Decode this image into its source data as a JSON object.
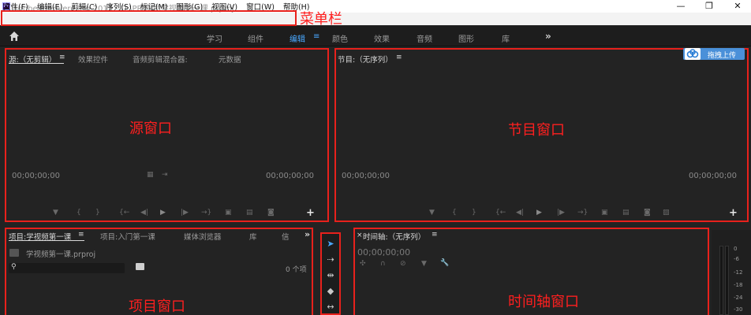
{
  "window": {
    "title": "Adobe Premiere Pro 2019 - D:\\PR剪辑\\学视频第一课.prproj",
    "icon_label": "Pr",
    "minimize": "—",
    "restore": "❐",
    "close": "✕"
  },
  "menu": {
    "items": [
      "文件(F)",
      "编辑(E)",
      "剪辑(C)",
      "序列(S)",
      "标记(M)",
      "图形(G)",
      "视图(V)",
      "窗口(W)",
      "帮助(H)"
    ],
    "annotation": "菜单栏"
  },
  "workspace": {
    "tabs": [
      "学习",
      "组件",
      "编辑",
      "颜色",
      "效果",
      "音频",
      "图形",
      "库"
    ],
    "active": "编辑",
    "more": "»"
  },
  "source_panel": {
    "tabs": [
      "源:（无剪辑）",
      "效果控件",
      "音频剪辑混合器:",
      "元数据"
    ],
    "timecode_left": "00;00;00;00",
    "timecode_right": "00;00;00;00",
    "annotation": "源窗口"
  },
  "program_panel": {
    "tab": "节目:（无序列）",
    "timecode_left": "00;00;00;00",
    "timecode_right": "00;00;00;00",
    "upload_label": "拖拽上传",
    "annotation": "节目窗口"
  },
  "project_panel": {
    "tabs": [
      "项目:学视频第一课",
      "项目:入门第一课",
      "媒体浏览器",
      "库",
      "信"
    ],
    "file_name": "学视频第一课.prproj",
    "item_count": "0 个项",
    "annotation": "项目窗口"
  },
  "timeline_panel": {
    "tab": "时间轴:（无序列）",
    "timecode": "00;00;00;00",
    "annotation": "时间轴窗口"
  },
  "audio_meter": {
    "labels": [
      "0",
      "-6",
      "-12",
      "-18",
      "-24",
      "-30"
    ]
  },
  "colors": {
    "annotation_red": "#e8211c",
    "accent_blue": "#4aa8ff",
    "panel_bg": "#232323"
  }
}
